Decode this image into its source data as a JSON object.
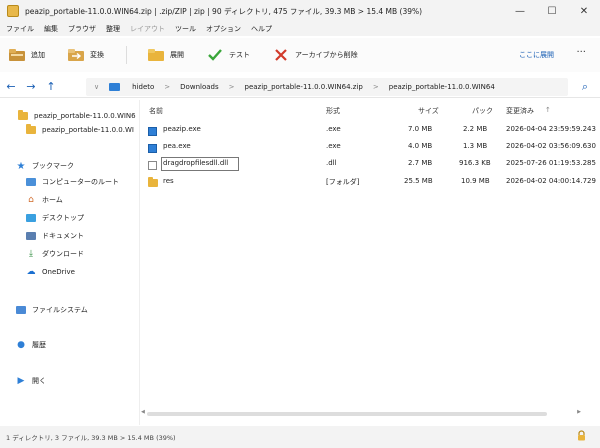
{
  "window": {
    "title": "peazip_portable-11.0.0.WIN64.zip | .zip/ZIP | zip | 90 ディレクトリ, 475 ファイル, 39.3 MB > 15.4 MB (39%)",
    "minimize_glyph": "—",
    "maximize_glyph": "☐",
    "close_glyph": "✕"
  },
  "menu": {
    "items": [
      "ファイル",
      "編集",
      "ブラウザ",
      "整理",
      "レイアウト",
      "ツール",
      "オプション",
      "ヘルプ"
    ]
  },
  "toolbar": {
    "add_label": "追加",
    "convert_label": "変換",
    "extract_label": "展開",
    "test_label": "テスト",
    "delete_label": "アーカイブから削除",
    "extract_here_label": "ここに展開",
    "more_glyph": "···"
  },
  "address": {
    "back_glyph": "←",
    "forward_glyph": "→",
    "up_glyph": "↑",
    "down_glyph": "∨",
    "crumbs": [
      "hideto",
      "Downloads",
      "peazip_portable-11.0.0.WIN64.zip",
      "peazip_portable-11.0.0.WIN64"
    ],
    "search_glyph": "⌕"
  },
  "sidebar": {
    "tree_root": "peazip_portable-11.0.0.WIN6",
    "tree_child": "peazip_portable-11.0.0.WI",
    "bookmarks": "ブックマーク",
    "items": [
      "コンピューターのルート",
      "ホーム",
      "デスクトップ",
      "ドキュメント",
      "ダウンロード",
      "OneDrive"
    ],
    "filesystem": "ファイルシステム",
    "history": "履歴",
    "open": "開く"
  },
  "table": {
    "headers": {
      "name": "名前",
      "type": "形式",
      "size": "サイズ",
      "packed": "パック",
      "modified": "変更済み",
      "sort_glyph": "↑"
    },
    "rows": [
      {
        "name": "peazip.exe",
        "type": ".exe",
        "size": "7.0 MB",
        "packed": "2.2 MB",
        "modified": "2026-04-04 23:59:59.243"
      },
      {
        "name": "pea.exe",
        "type": ".exe",
        "size": "4.0 MB",
        "packed": "1.3 MB",
        "modified": "2026-04-02 03:56:09.630"
      },
      {
        "name": "dragdropfilesdll.dll",
        "type": ".dll",
        "size": "2.7 MB",
        "packed": "916.3 KB",
        "modified": "2025-07-26 01:19:53.285"
      },
      {
        "name": "res",
        "type": "[フォルダ]",
        "size": "25.5 MB",
        "packed": "10.9 MB",
        "modified": "2026-04-02 04:00:14.729"
      }
    ]
  },
  "status": {
    "text": "1 ディレクトリ, 3 ファイル, 39.3 MB > 15.4 MB (39%)"
  },
  "colors": {
    "accent": "#1a5fb4",
    "folder": "#e9b43c"
  }
}
